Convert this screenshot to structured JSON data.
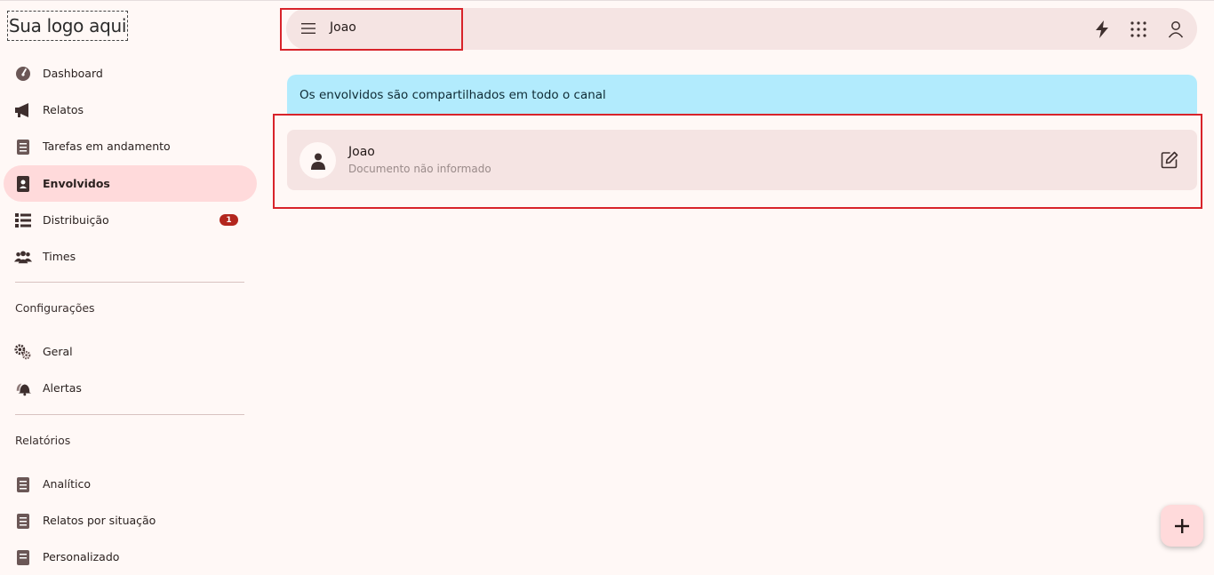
{
  "logo": {
    "text": "Sua logo aqui"
  },
  "sidebar": {
    "items": [
      {
        "label": "Dashboard"
      },
      {
        "label": "Relatos"
      },
      {
        "label": "Tarefas em andamento"
      },
      {
        "label": "Envolvidos"
      },
      {
        "label": "Distribuição",
        "badge": "1"
      },
      {
        "label": "Times"
      }
    ],
    "config": {
      "title": "Configurações",
      "items": [
        {
          "label": "Geral"
        },
        {
          "label": "Alertas"
        }
      ]
    },
    "reports": {
      "title": "Relatórios",
      "items": [
        {
          "label": "Analítico"
        },
        {
          "label": "Relatos por situação"
        },
        {
          "label": "Personalizado"
        }
      ]
    }
  },
  "header": {
    "title": "Joao"
  },
  "info": {
    "text": "Os envolvidos são compartilhados em todo o canal"
  },
  "card": {
    "name": "Joao",
    "document": "Documento não informado"
  },
  "colors": {
    "active": "#ffdadb",
    "info": "#b2ebfd",
    "badge": "#b3261e",
    "highlight": "#d8232a"
  },
  "icons": {
    "dashboard": "gauge-icon",
    "relatos": "megaphone-icon",
    "tarefas": "clipboard-icon",
    "envolvidos": "id-badge-icon",
    "distribuicao": "list-icon",
    "times": "users-icon",
    "geral": "gears-icon",
    "alertas": "bell-icon"
  }
}
